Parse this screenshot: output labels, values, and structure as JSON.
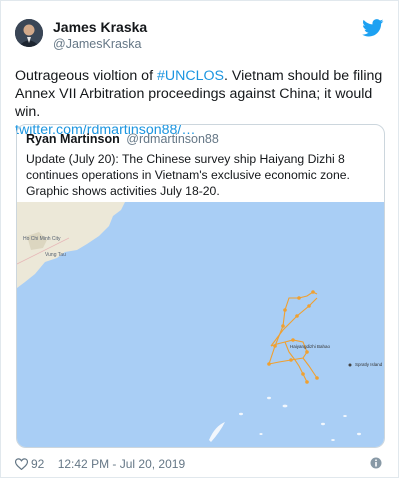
{
  "author": {
    "name": "James Kraska",
    "handle": "@JamesKraska"
  },
  "tweet": {
    "text_before": "Outrageous violtion of ",
    "hashtag": "#UNCLOS",
    "text_after": ". Vietnam should be filing Annex VII Arbitration proceedings against China; it would win.",
    "link": "twitter.com/rdmartinson88/…"
  },
  "quoted": {
    "name": "Ryan Martinson",
    "handle": "@rdmartinson88",
    "text": "Update (July 20): The Chinese survey ship Haiyang Dizhi 8 continues operations in Vietnam's exclusive economic zone.  Graphic shows activities July 18-20.",
    "map": {
      "labels": {
        "city": "Ho Chi Minh City",
        "town": "Vung Tau",
        "ship": "Haiyangdizhi Bahao",
        "island": "Spratly Island"
      },
      "colors": {
        "sea": "#a9cef5",
        "land": "#ece8d8",
        "track": "#f0a030"
      }
    }
  },
  "footer": {
    "likes": "92",
    "timestamp": "12:42 PM - Jul 20, 2019"
  }
}
